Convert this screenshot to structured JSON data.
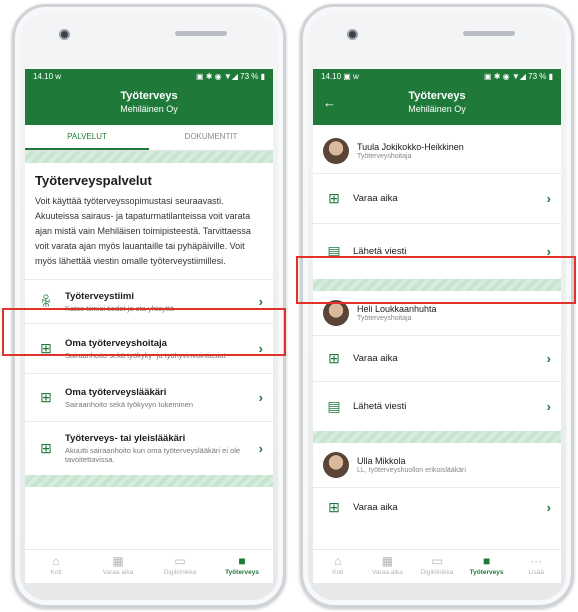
{
  "left": {
    "status": {
      "time": "14.10",
      "left_icon": "w",
      "right_icons": "▣ ✱ ◉ ▼◢ 73 % ▮"
    },
    "appbar": {
      "title": "Työterveys",
      "subtitle": "Mehiläinen Oy"
    },
    "tabs": [
      {
        "label": "PALVELUT"
      },
      {
        "label": "DOKUMENTIT"
      }
    ],
    "section_title": "Työterveyspalvelut",
    "body": "Voit käyttää työterveyssopimustasi seuraavasti. Akuuteissa sairaus- ja tapaturmatilanteissa voit varata ajan mistä vain Mehiläisen toimipisteestä. Tarvittaessa voit varata ajan myös lauantaille tai pyhäpäiville. Voit myös lähettää viestin omalle työterveystiimillesi.",
    "rows": [
      {
        "title": "Työterveystiimi",
        "subtitle": "Katso tiimisi tiedot ja ota yhteyttä",
        "icon": "team-icon"
      },
      {
        "title": "Oma työterveyshoitaja",
        "subtitle": "Sairaanhoito sekä työkyky- ja työhyvinvointiasiat",
        "icon": "calendar-plus-icon"
      },
      {
        "title": "Oma työterveyslääkäri",
        "subtitle": "Sairaanhoito sekä työkyvyn tukeminen",
        "icon": "calendar-plus-icon"
      },
      {
        "title": "Työterveys- tai yleislääkäri",
        "subtitle": "Akuutti sairaanhoito kun oma työterveyslääkäri ei ole tavoitettavissa.",
        "icon": "calendar-plus-icon"
      }
    ],
    "nav": [
      {
        "label": "Koti",
        "icon": "home-icon"
      },
      {
        "label": "Varaa aika",
        "icon": "calendar-icon"
      },
      {
        "label": "Digiklinikka",
        "icon": "chat-icon"
      },
      {
        "label": "Työterveys",
        "icon": "briefcase-icon"
      }
    ]
  },
  "right": {
    "status": {
      "time": "14.10",
      "left_icon": "▣ w",
      "right_icons": "▣ ✱ ◉ ▼◢ 73 % ▮"
    },
    "appbar": {
      "title": "Työterveys",
      "subtitle": "Mehiläinen Oy"
    },
    "people": [
      {
        "name": "Tuula Jokikokko-Heikkinen",
        "role": "Työterveyshoitaja"
      },
      {
        "name": "Heli Loukkaanhuhta",
        "role": "Työterveyshoitaja"
      },
      {
        "name": "Ulla Mikkola",
        "role": "LL, työterveyshuollon erikoislääkäri"
      }
    ],
    "actions": {
      "book": "Varaa aika",
      "message": "Lähetä viesti"
    },
    "nav": [
      {
        "label": "Koti",
        "icon": "home-icon"
      },
      {
        "label": "Varaa aika",
        "icon": "calendar-icon"
      },
      {
        "label": "Digiklinikka",
        "icon": "chat-icon"
      },
      {
        "label": "Työterveys",
        "icon": "briefcase-icon"
      },
      {
        "label": "Lisää",
        "icon": "more-icon"
      }
    ]
  },
  "colors": {
    "brand": "#1f7a3a",
    "highlight": "#e0312b"
  }
}
